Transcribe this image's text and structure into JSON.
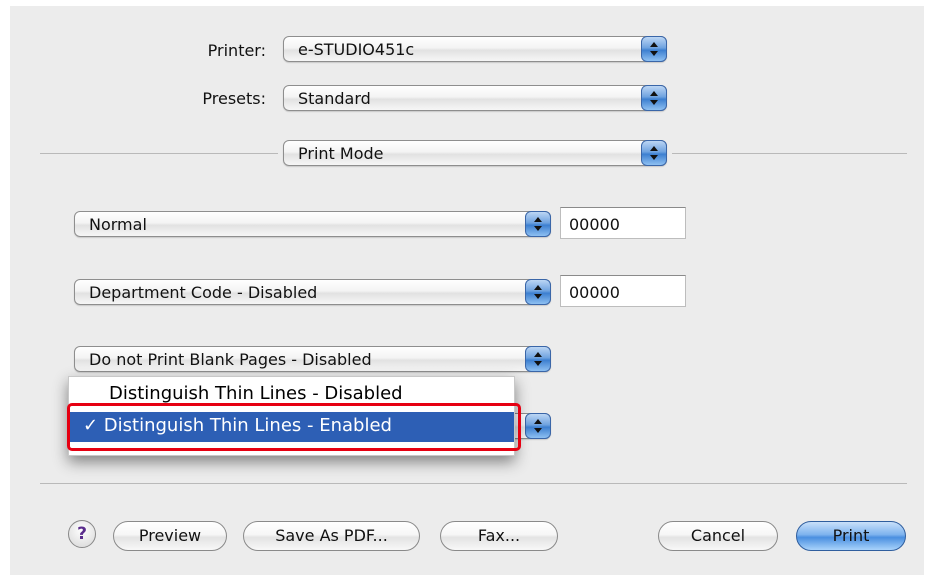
{
  "printer": {
    "label": "Printer:",
    "value": "e-STUDIO451c"
  },
  "presets": {
    "label": "Presets:",
    "value": "Standard"
  },
  "pane": {
    "value": "Print Mode"
  },
  "print_mode": {
    "value": "Normal",
    "code": "00000"
  },
  "department": {
    "value": "Department Code - Disabled",
    "code": "00000"
  },
  "blank_pages": {
    "value": "Do not Print Blank Pages - Disabled"
  },
  "thin_lines_menu": {
    "items": [
      {
        "label": "Distinguish Thin Lines - Disabled",
        "selected": false
      },
      {
        "label": "✓ Distinguish Thin Lines - Enabled",
        "selected": true
      }
    ]
  },
  "buttons": {
    "help": "?",
    "preview": "Preview",
    "save_pdf": "Save As PDF...",
    "fax": "Fax...",
    "cancel": "Cancel",
    "print": "Print"
  },
  "colors": {
    "highlight": "#2d5fb5",
    "annotation": "#e60012",
    "default_button": "#4a8fe0"
  }
}
